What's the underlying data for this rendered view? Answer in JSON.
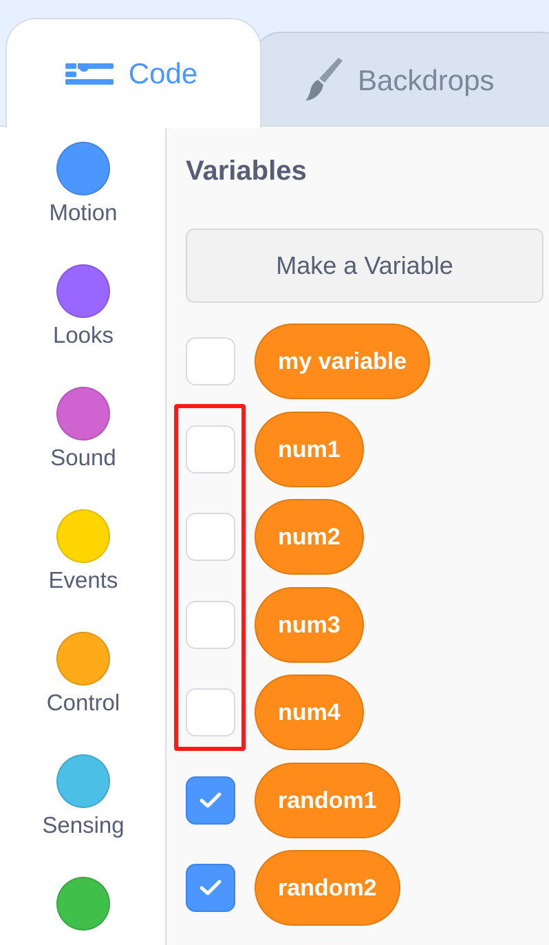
{
  "tabs": {
    "code": {
      "label": "Code",
      "icon": "code-icon",
      "color": "#4c97ff"
    },
    "backdrops": {
      "label": "Backdrops",
      "icon": "brush-icon"
    }
  },
  "categories": [
    {
      "label": "Motion",
      "color": "#4c97ff"
    },
    {
      "label": "Looks",
      "color": "#9966ff"
    },
    {
      "label": "Sound",
      "color": "#cf63cf"
    },
    {
      "label": "Events",
      "color": "#ffd500"
    },
    {
      "label": "Control",
      "color": "#ffab19"
    },
    {
      "label": "Sensing",
      "color": "#4cbfe6"
    },
    {
      "label": "",
      "color": "#40bf4a"
    }
  ],
  "palette": {
    "heading": "Variables",
    "make_variable_label": "Make a Variable",
    "variables": [
      {
        "name": "my variable",
        "checked": false
      },
      {
        "name": "num1",
        "checked": false
      },
      {
        "name": "num2",
        "checked": false
      },
      {
        "name": "num3",
        "checked": false
      },
      {
        "name": "num4",
        "checked": false
      },
      {
        "name": "random1",
        "checked": true
      },
      {
        "name": "random2",
        "checked": true
      }
    ]
  },
  "colors": {
    "reporter": "#ff8c1a",
    "highlight": "#ff1a1a",
    "checkbox_checked": "#4c97ff"
  }
}
